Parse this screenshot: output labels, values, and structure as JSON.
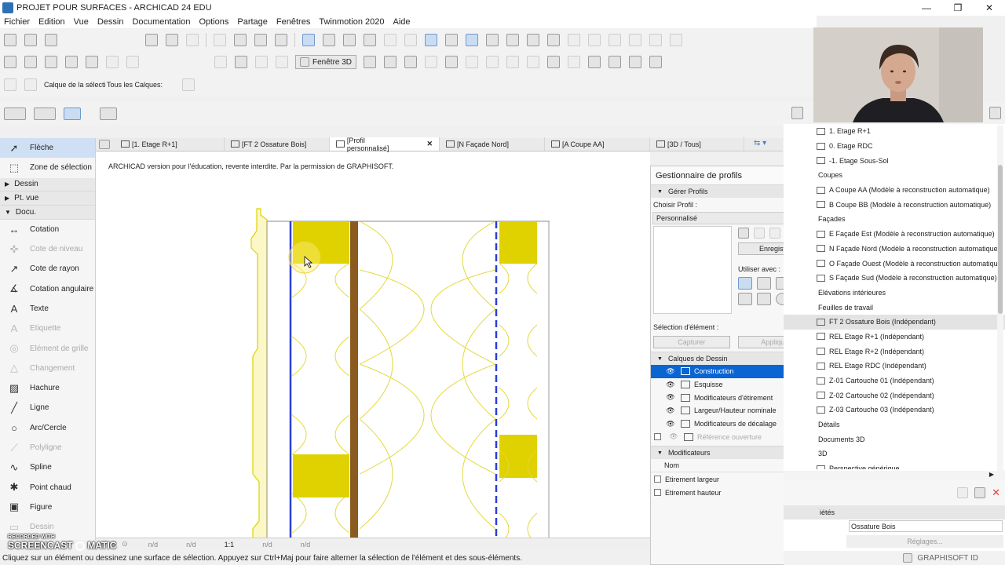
{
  "window": {
    "title": "PROJET POUR SURFACES - ARCHICAD 24 EDU"
  },
  "menu": [
    "Fichier",
    "Edition",
    "Vue",
    "Dessin",
    "Documentation",
    "Options",
    "Partage",
    "Fenêtres",
    "Twinmotion 2020",
    "Aide"
  ],
  "toolbar": {
    "fenetre3d_label": "Fenêtre 3D",
    "layer_label": "Calque de la sélecti",
    "all_layers_label": "Tous les Calques:"
  },
  "toolbox": {
    "sections": {
      "dessin": "Dessin",
      "ptvue": "Pt. vue",
      "docu": "Docu."
    },
    "top": [
      {
        "label": "Flèche",
        "icon": "arrow-icon",
        "glyph": "➚",
        "active": true
      },
      {
        "label": "Zone de sélection",
        "icon": "marquee-icon",
        "glyph": "⬚"
      }
    ],
    "docu": [
      {
        "label": "Cotation",
        "icon": "dimension-icon",
        "glyph": "↔"
      },
      {
        "label": "Cote de niveau",
        "icon": "level-dimension-icon",
        "glyph": "✜",
        "dim": true
      },
      {
        "label": "Cote de rayon",
        "icon": "radial-dimension-icon",
        "glyph": "↗"
      },
      {
        "label": "Cotation angulaire",
        "icon": "angle-dimension-icon",
        "glyph": "∡"
      },
      {
        "label": "Texte",
        "icon": "text-icon",
        "glyph": "A"
      },
      {
        "label": "Etiquette",
        "icon": "label-icon",
        "glyph": "A",
        "dim": true
      },
      {
        "label": "Elément de grille",
        "icon": "grid-element-icon",
        "glyph": "◎",
        "dim": true
      },
      {
        "label": "Changement",
        "icon": "change-icon",
        "glyph": "△",
        "dim": true
      },
      {
        "label": "Hachure",
        "icon": "fill-icon",
        "glyph": "▨"
      },
      {
        "label": "Ligne",
        "icon": "line-icon",
        "glyph": "╱"
      },
      {
        "label": "Arc/Cercle",
        "icon": "arc-circle-icon",
        "glyph": "○"
      },
      {
        "label": "Polyligne",
        "icon": "polyline-icon",
        "glyph": "⟋",
        "dim": true
      },
      {
        "label": "Spline",
        "icon": "spline-icon",
        "glyph": "∿"
      },
      {
        "label": "Point chaud",
        "icon": "hotspot-icon",
        "glyph": "✱"
      },
      {
        "label": "Figure",
        "icon": "figure-icon",
        "glyph": "▣"
      },
      {
        "label": "Dessin",
        "icon": "drawing-icon",
        "glyph": "▭",
        "dim": true
      }
    ]
  },
  "tabs": [
    {
      "label": "[1. Etage R+1]"
    },
    {
      "label": "[FT 2 Ossature Bois]"
    },
    {
      "label": "[Profil personnalisé]",
      "active": true,
      "close": "✕"
    },
    {
      "label": "[N Façade Nord]"
    },
    {
      "label": "[A Coupe AA]"
    },
    {
      "label": "[3D / Tous]"
    }
  ],
  "canvas": {
    "edu_notice": "ARCHICAD version pour l'éducation, revente interdite. Par la permission de GRAPHISOFT."
  },
  "navbar": {
    "values": [
      "n/d",
      "n/d",
      "1:1",
      "n/d",
      "n/d"
    ]
  },
  "status": {
    "text": "Cliquez sur un élément ou dessinez une surface de sélection. Appuyez sur Ctrl+Maj pour faire alterner la sélection de l'élément et des sous-éléments."
  },
  "watermark": {
    "line1": "RECORDED WITH",
    "line2": "SCREENCAST",
    "line3": "MATIC"
  },
  "profile_manager": {
    "title": "Gestionnaire de profils",
    "gerer": "Gérer Profils",
    "choisir": "Choisir Profil :",
    "selected_profile": "Personnalisé",
    "enregistrer": "Enregistrer",
    "utiliser_avec": "Utiliser avec :",
    "selection_element": "Sélection d'élément :",
    "capturer": "Capturer",
    "appliquer": "Appliquer",
    "calques_title": "Calques de Dessin",
    "layers": [
      {
        "label": "Construction",
        "selected": true
      },
      {
        "label": "Esquisse"
      },
      {
        "label": "Modificateurs d'étirement"
      },
      {
        "label": "Largeur/Hauteur nominale"
      },
      {
        "label": "Modificateurs de décalage"
      },
      {
        "label": "Référence ouverture",
        "dim": true
      }
    ],
    "modificateurs_title": "Modificateurs",
    "nom_header": "Nom",
    "modificateurs": [
      {
        "label": "Etirement largeur"
      },
      {
        "label": "Etirement hauteur"
      }
    ]
  },
  "navigator": {
    "items": [
      {
        "label": "1. Etage R+1",
        "indent": 1,
        "icon": true
      },
      {
        "label": "0. Etage RDC",
        "indent": 1,
        "icon": true
      },
      {
        "label": "-1. Etage Sous-Sol",
        "indent": 1,
        "icon": true
      },
      {
        "label": "Coupes",
        "indent": 0
      },
      {
        "label": "A Coupe AA (Modèle à reconstruction automatique)",
        "indent": 1
      },
      {
        "label": "B Coupe BB (Modèle à reconstruction automatique)",
        "indent": 1
      },
      {
        "label": "Façades",
        "indent": 0
      },
      {
        "label": "E Façade Est (Modèle à reconstruction automatique)",
        "indent": 1
      },
      {
        "label": "N Façade Nord (Modèle à reconstruction automatique)",
        "indent": 1
      },
      {
        "label": "O Façade Ouest (Modèle à reconstruction automatique)",
        "indent": 1
      },
      {
        "label": "S Façade Sud (Modèle à reconstruction automatique)",
        "indent": 1
      },
      {
        "label": "Elévations intérieures",
        "indent": 0
      },
      {
        "label": "Feuilles de travail",
        "indent": 0
      },
      {
        "label": "FT 2 Ossature Bois (Indépendant)",
        "indent": 1,
        "highlight": true
      },
      {
        "label": "REL  Etage R+1 (Indépendant)",
        "indent": 1
      },
      {
        "label": "REL Etage R+2 (Indépendant)",
        "indent": 1
      },
      {
        "label": "REL Etage RDC (Indépendant)",
        "indent": 1
      },
      {
        "label": "Z-01 Cartouche 01 (Indépendant)",
        "indent": 1
      },
      {
        "label": "Z-02 Cartouche 02 (Indépendant)",
        "indent": 1
      },
      {
        "label": "Z-03 Cartouche 03 (Indépendant)",
        "indent": 1
      },
      {
        "label": "Détails",
        "indent": 0
      },
      {
        "label": "Documents 3D",
        "indent": 0
      },
      {
        "label": "3D",
        "indent": 0
      },
      {
        "label": "Perspective générique",
        "indent": 1
      }
    ],
    "props_label": "iétés",
    "props_value": "Ossature Bois",
    "reglages": "Réglages...",
    "brand": "GRAPHISOFT ID"
  },
  "colors": {
    "profile_yellow": "#dfd200",
    "insulation_stroke": "#e2d93a",
    "membrane_blue": "#2c3fd6",
    "wood_brown": "#8a5a1e",
    "selection_blue": "#0a64d2"
  }
}
